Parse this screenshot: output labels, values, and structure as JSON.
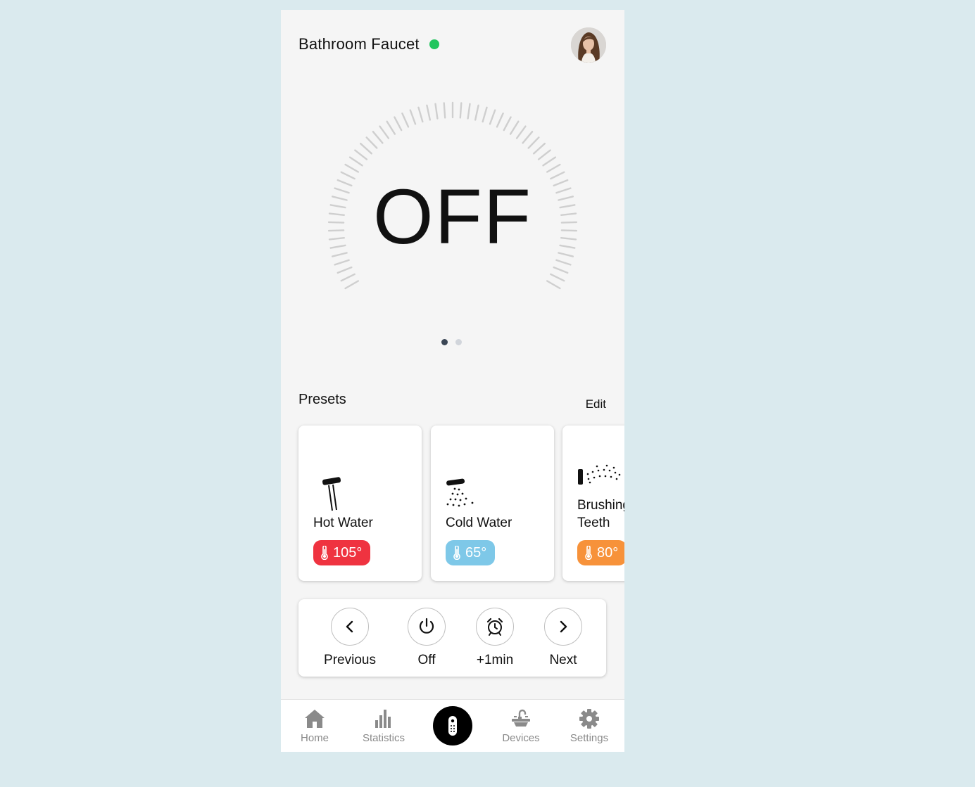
{
  "header": {
    "title": "Bathroom Faucet",
    "status_color": "#22c55e"
  },
  "dial": {
    "state": "OFF"
  },
  "pager": {
    "total": 2,
    "active": 1
  },
  "presets": {
    "title": "Presets",
    "edit_label": "Edit",
    "items": [
      {
        "label": "Hot Water",
        "temp": "105°",
        "color": "#ef3340",
        "icon": "faucet-stream-icon"
      },
      {
        "label": "Cold Water",
        "temp": "65°",
        "color": "#7ec8e8",
        "icon": "faucet-drops-icon"
      },
      {
        "label": "Brushing\nTeeth",
        "temp": "80°",
        "color": "#f7923a",
        "icon": "spray-icon"
      }
    ]
  },
  "controls": {
    "previous_label": "Previous",
    "off_label": "Off",
    "plus_min_label": "+1min",
    "next_label": "Next"
  },
  "nav": {
    "home_label": "Home",
    "statistics_label": "Statistics",
    "devices_label": "Devices",
    "settings_label": "Settings"
  }
}
